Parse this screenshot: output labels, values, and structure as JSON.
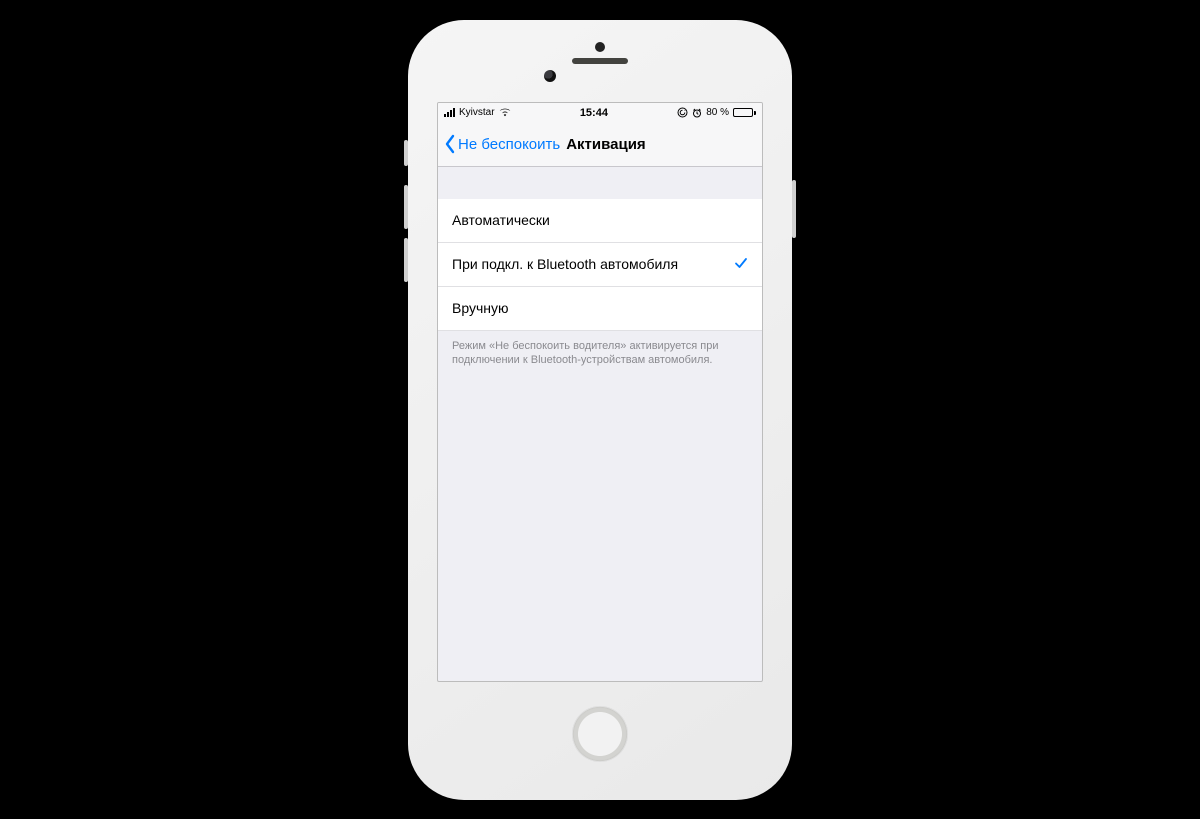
{
  "status": {
    "carrier": "Kyivstar",
    "time": "15:44",
    "battery_text": "80 %"
  },
  "nav": {
    "back_label": "Не беспокоить",
    "title": "Активация"
  },
  "options": {
    "auto": "Автоматически",
    "bluetooth": "При подкл. к Bluetooth автомобиля",
    "manual": "Вручную",
    "selected_index": 1
  },
  "footer": "Режим «Не беспокоить водителя» активируется при подключении к Bluetooth-устройствам автомобиля."
}
